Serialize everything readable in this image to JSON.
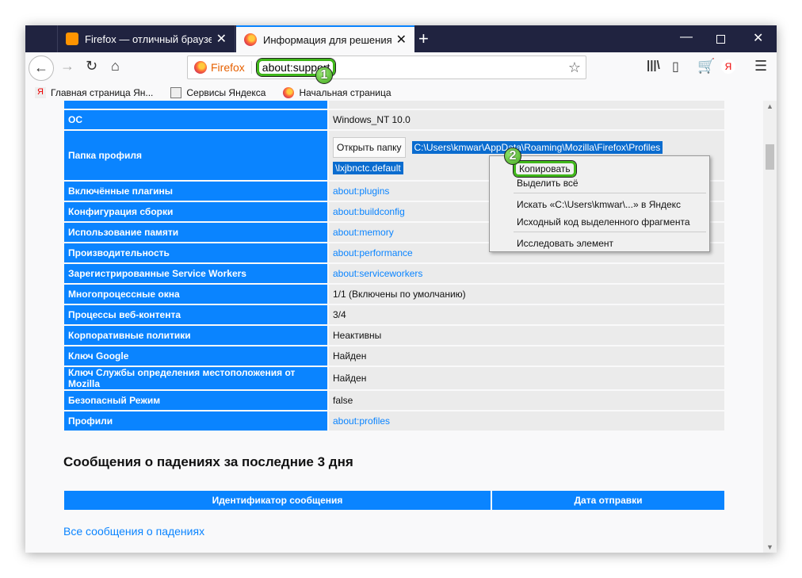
{
  "tabs": [
    {
      "title": "Firefox — отличный браузер д",
      "icon": "firefox-fox-icon"
    },
    {
      "title": "Информация для решения пр",
      "icon": "firefox-icon",
      "active": true
    }
  ],
  "url": {
    "identity": "Firefox",
    "address": "about:support"
  },
  "badges": [
    "1",
    "2"
  ],
  "bookmarks": [
    {
      "label": "Главная страница Ян...",
      "icon": "yandex-icon"
    },
    {
      "label": "Сервисы Яндекса",
      "icon": "folder-icon"
    },
    {
      "label": "Начальная страница",
      "icon": "firefox-icon"
    }
  ],
  "rows": [
    {
      "k": "ОС",
      "v": "Windows_NT 10.0"
    },
    {
      "k": "Папка профиля",
      "button": "Открыть папку",
      "path1": "C:\\Users\\kmwar\\AppData\\Roaming\\Mozilla\\Firefox\\Profiles",
      "path2": "\\lxjbnctc.default"
    },
    {
      "k": "Включённые плагины",
      "v": "about:plugins",
      "link": true
    },
    {
      "k": "Конфигурация сборки",
      "v": "about:buildconfig",
      "link": true
    },
    {
      "k": "Использование памяти",
      "v": "about:memory",
      "link": true
    },
    {
      "k": "Производительность",
      "v": "about:performance",
      "link": true
    },
    {
      "k": "Зарегистрированные Service Workers",
      "v": "about:serviceworkers",
      "link": true
    },
    {
      "k": "Многопроцессные окна",
      "v": "1/1 (Включены по умолчанию)"
    },
    {
      "k": "Процессы веб-контента",
      "v": "3/4"
    },
    {
      "k": "Корпоративные политики",
      "v": "Неактивны"
    },
    {
      "k": "Ключ Google",
      "v": "Найден"
    },
    {
      "k": "Ключ Службы определения местоположения от Mozilla",
      "v": "Найден"
    },
    {
      "k": "Безопасный Режим",
      "v": "false"
    },
    {
      "k": "Профили",
      "v": "about:profiles",
      "link": true
    }
  ],
  "crash": {
    "heading": "Сообщения о падениях за последние 3 дня",
    "col1": "Идентификатор сообщения",
    "col2": "Дата отправки",
    "link": "Все сообщения о падениях"
  },
  "menu": [
    "Копировать",
    "Выделить всё",
    "Искать «C:\\Users\\kmwar\\...» в Яндекс",
    "Исходный код выделенного фрагмента",
    "Исследовать элемент"
  ],
  "colors": {
    "accent": "#0a84ff",
    "tabbar": "#202340",
    "highlight": "#3fb619"
  }
}
